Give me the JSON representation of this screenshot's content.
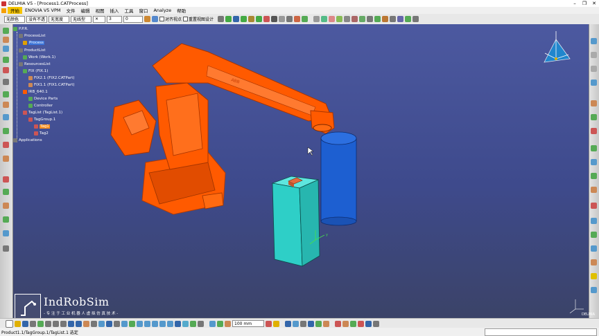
{
  "window": {
    "app_name": "DELMIA V5",
    "doc_title": "[Process1.CATProcess]",
    "controls": [
      "–",
      "❐",
      "✕"
    ]
  },
  "menu": [
    "开始",
    "ENOVIA V5 VPM",
    "文件",
    "编辑",
    "视图",
    "插入",
    "工具",
    "窗口",
    "Analyze",
    "帮助"
  ],
  "toolbar": {
    "color_select": "无颜色",
    "line_select": "没有不透",
    "weight_select": "无宽度",
    "style_select": "无线型",
    "num_value": "3",
    "num_value2": "0",
    "align_label": "对齐视点",
    "grid_label": "重置视图设计"
  },
  "tree": {
    "root": "P.P.R.",
    "items": [
      {
        "label": "ProcessList"
      },
      {
        "label": "Process",
        "selected": true
      },
      {
        "label": "ProductList"
      },
      {
        "label": "Work (Work.1)"
      },
      {
        "label": "ResourcesList"
      },
      {
        "label": "FIX (FIX.1)"
      },
      {
        "label": "FIX2.1 (FIX2.CATPart)"
      },
      {
        "label": "FIX1.1 (FIX1.CATPart)"
      },
      {
        "label": "IRB_640.1"
      },
      {
        "label": "Device Parts"
      },
      {
        "label": "Controller"
      },
      {
        "label": "TagList (TagList.1)"
      },
      {
        "label": "TagGroup.1"
      },
      {
        "label": "Tag1",
        "highlight": true
      },
      {
        "label": "Tag2"
      },
      {
        "label": "Applications"
      }
    ]
  },
  "robot": {
    "brand": "ABB",
    "color": "#ff5a00"
  },
  "scene": {
    "box_color": "#2ecfc7",
    "cylinder_color": "#1d5fd1",
    "part_color": "#e36a3f",
    "axis_labels": {
      "x": "x",
      "y": "y",
      "z": "z"
    }
  },
  "logo": {
    "name": "IndRobSim",
    "slogan": "- 专 注 于 工 业 机 器 人 虚 拟 仿 真 技 术 -"
  },
  "bottom_toolbar": {
    "unit_select": "100 mm"
  },
  "status": {
    "text": "Product1.1/TagGroup.1/TagList.1 选定"
  },
  "brand_mark": "DELMIA"
}
